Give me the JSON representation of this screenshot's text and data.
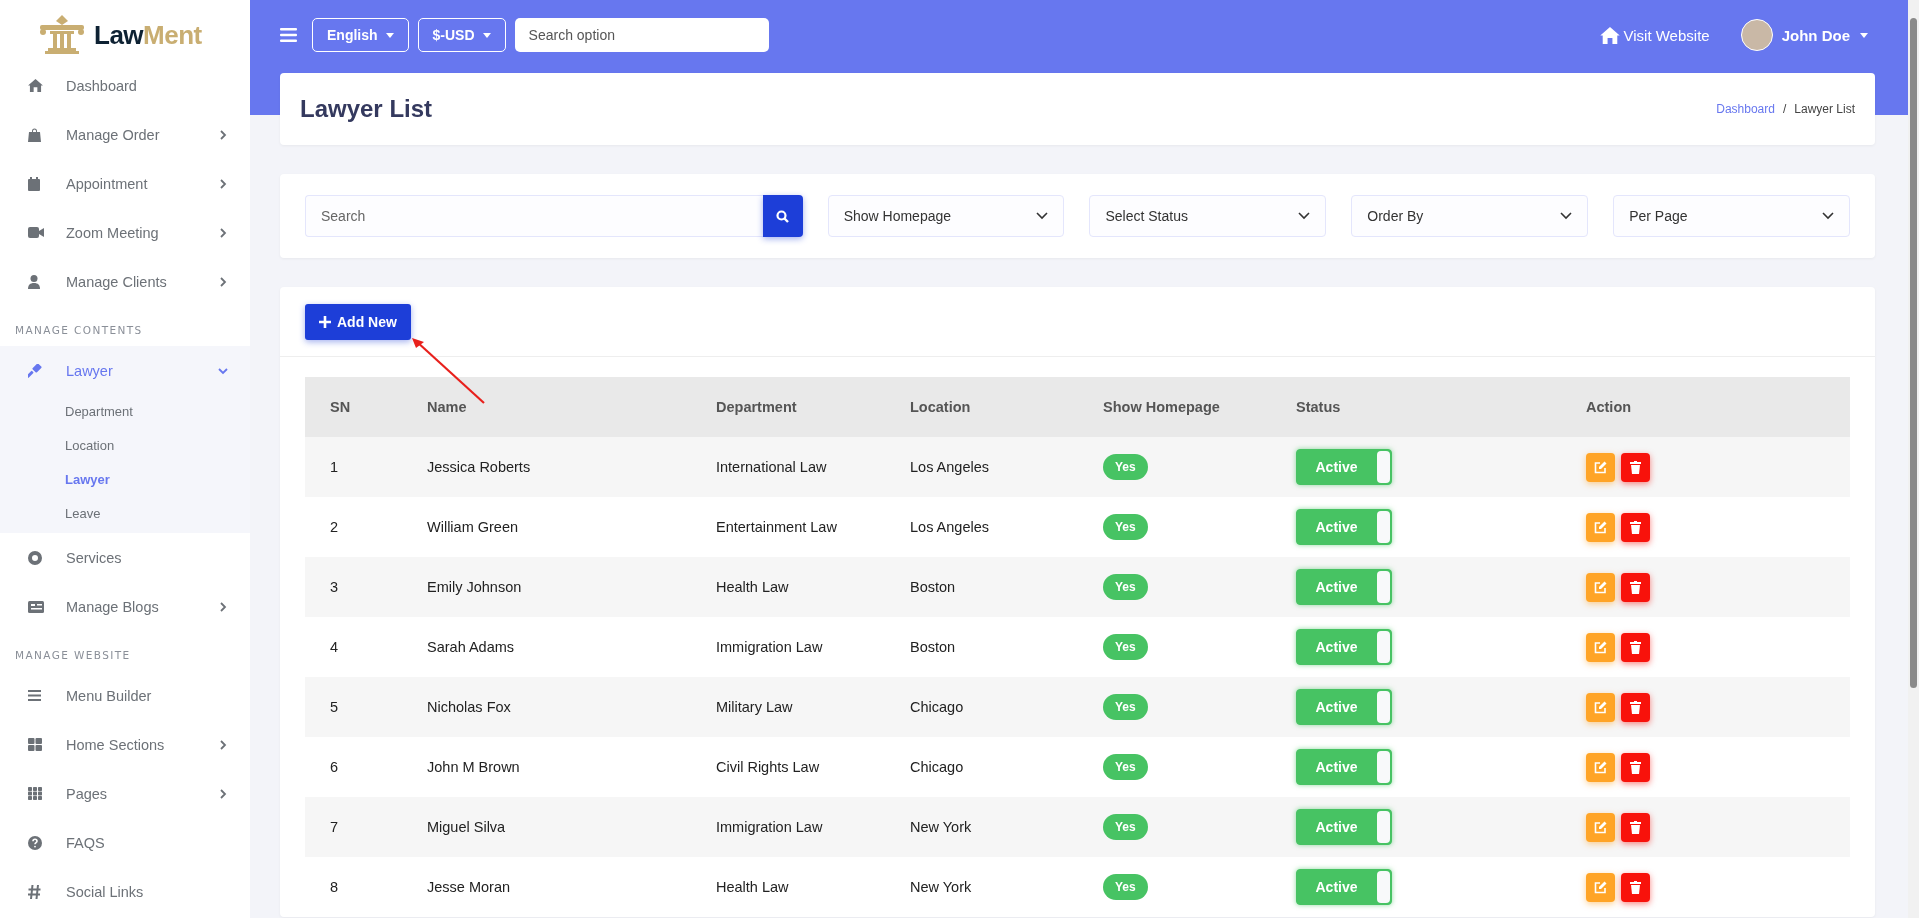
{
  "brand": {
    "part_1": "Law",
    "part_2": "Ment"
  },
  "sidebar": {
    "sections": [
      {
        "items": [
          {
            "label": "Dashboard",
            "kind": "link",
            "selected": false
          },
          {
            "label": "Manage Order",
            "kind": "menu",
            "expanded": false,
            "selected": false
          },
          {
            "label": "Appointment",
            "kind": "menu",
            "expanded": false,
            "selected": false
          },
          {
            "label": "Zoom Meeting",
            "kind": "menu",
            "expanded": false,
            "selected": false
          },
          {
            "label": "Manage Clients",
            "kind": "menu",
            "expanded": false,
            "selected": false
          }
        ]
      },
      {
        "heading": "MANAGE CONTENTS",
        "items": [
          {
            "label": "Lawyer",
            "kind": "menu",
            "expanded": true,
            "selected": true,
            "children": [
              {
                "label": "Department",
                "selected": false
              },
              {
                "label": "Location",
                "selected": false
              },
              {
                "label": "Lawyer",
                "selected": true
              },
              {
                "label": "Leave",
                "selected": false
              }
            ]
          },
          {
            "label": "Services",
            "kind": "link",
            "selected": false
          },
          {
            "label": "Manage Blogs",
            "kind": "menu",
            "expanded": false,
            "selected": false
          }
        ]
      },
      {
        "heading": "MANAGE WEBSITE",
        "items": [
          {
            "label": "Menu Builder",
            "kind": "link",
            "selected": false
          },
          {
            "label": "Home Sections",
            "kind": "menu",
            "expanded": false,
            "selected": false
          },
          {
            "label": "Pages",
            "kind": "menu",
            "expanded": false,
            "selected": false
          },
          {
            "label": "FAQS",
            "kind": "link",
            "selected": false
          },
          {
            "label": "Social Links",
            "kind": "link",
            "selected": false
          }
        ]
      }
    ]
  },
  "topbar": {
    "language": "English",
    "currency": "$-USD",
    "search": {
      "placeholder": "Search option"
    },
    "visit_website": "Visit Website",
    "user": "John Doe"
  },
  "header": {
    "title": "Lawyer List",
    "separator": "/",
    "breadcrumb": [
      {
        "label": "Dashboard",
        "kind": "link"
      },
      {
        "label": "Lawyer List",
        "kind": "current"
      }
    ]
  },
  "filters": {
    "search": {
      "placeholder": "Search"
    },
    "selects": [
      "Show Homepage",
      "Select Status",
      "Order By",
      "Per Page"
    ]
  },
  "add_button": "Add New",
  "table": {
    "columns": [
      "SN",
      "Name",
      "Department",
      "Location",
      "Show Homepage",
      "Status",
      "Action"
    ],
    "rows": [
      {
        "sn": "1",
        "name": "Jessica Roberts",
        "department": "International Law",
        "location": "Los Angeles",
        "show_homepage": "Yes",
        "status": "Active",
        "on": true
      },
      {
        "sn": "2",
        "name": "William Green",
        "department": "Entertainment Law",
        "location": "Los Angeles",
        "show_homepage": "Yes",
        "status": "Active",
        "on": true
      },
      {
        "sn": "3",
        "name": "Emily Johnson",
        "department": "Health Law",
        "location": "Boston",
        "show_homepage": "Yes",
        "status": "Active",
        "on": true
      },
      {
        "sn": "4",
        "name": "Sarah Adams",
        "department": "Immigration Law",
        "location": "Boston",
        "show_homepage": "Yes",
        "status": "Active",
        "on": true
      },
      {
        "sn": "5",
        "name": "Nicholas Fox",
        "department": "Military Law",
        "location": "Chicago",
        "show_homepage": "Yes",
        "status": "Active",
        "on": true
      },
      {
        "sn": "6",
        "name": "John M Brown",
        "department": "Civil Rights Law",
        "location": "Chicago",
        "show_homepage": "Yes",
        "status": "Active",
        "on": true
      },
      {
        "sn": "7",
        "name": "Miguel Silva",
        "department": "Immigration Law",
        "location": "New York",
        "show_homepage": "Yes",
        "status": "Active",
        "on": true
      },
      {
        "sn": "8",
        "name": "Jesse Moran",
        "department": "Health Law",
        "location": "New York",
        "show_homepage": "Yes",
        "status": "Active",
        "on": true
      }
    ]
  }
}
